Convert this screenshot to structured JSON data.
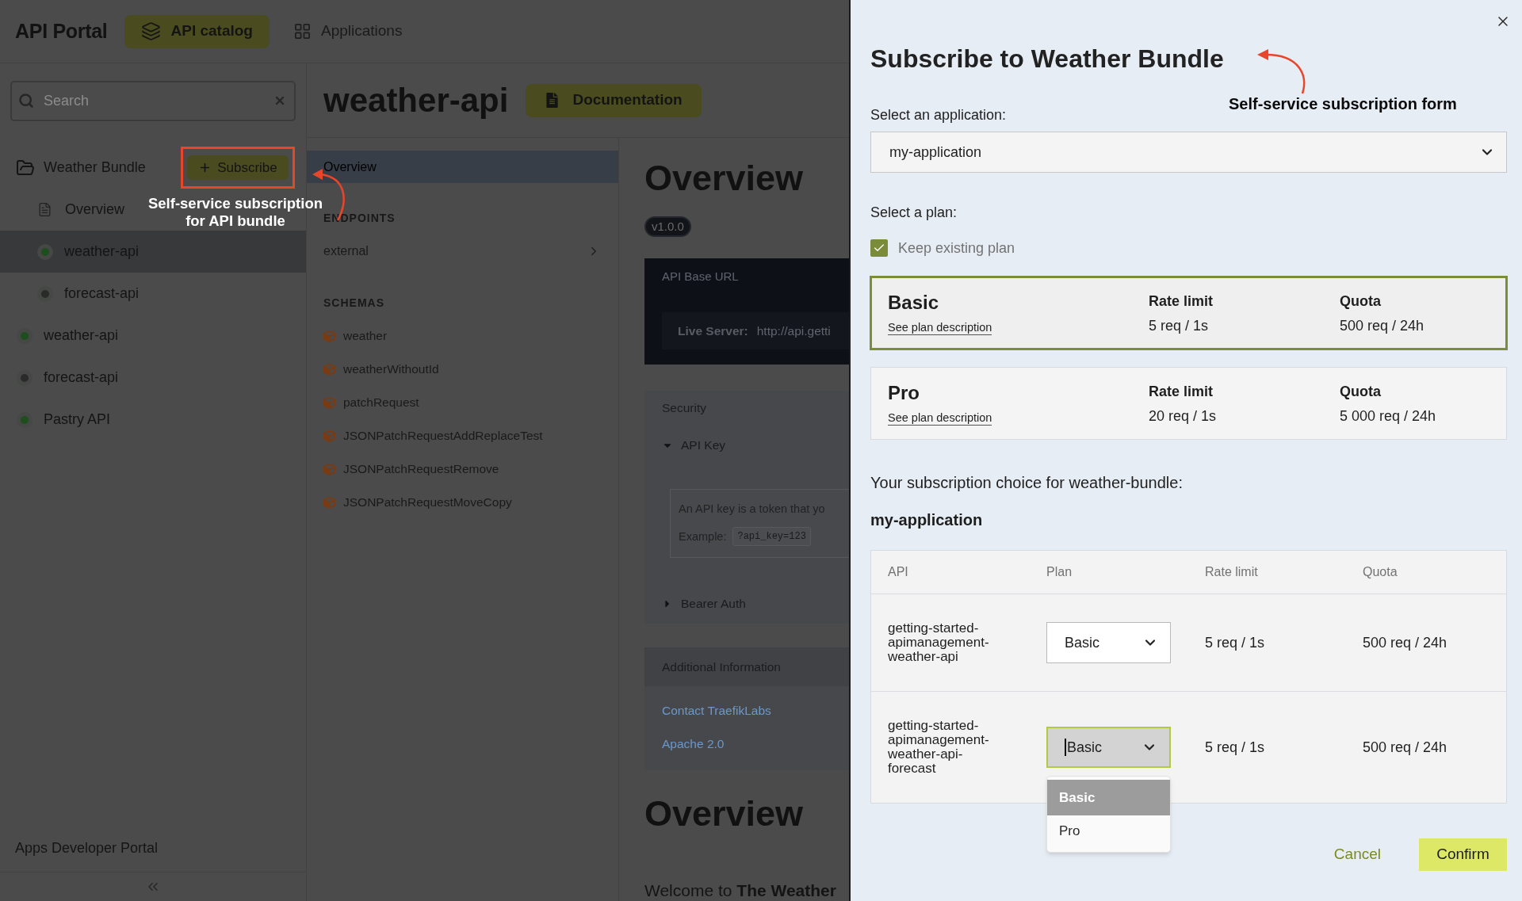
{
  "header": {
    "logo": "API Portal",
    "tabs": [
      {
        "label": "API catalog",
        "selected": true
      },
      {
        "label": "Applications",
        "selected": false
      }
    ]
  },
  "sidebar": {
    "search": {
      "placeholder": "Search"
    },
    "items": [
      {
        "kind": "bundle",
        "label": "Weather Bundle",
        "action": "Subscribe",
        "children": [
          {
            "kind": "doc",
            "label": "Overview",
            "selected": false
          },
          {
            "kind": "api",
            "label": "weather-api",
            "selected": true,
            "color": "#1e4d1e"
          },
          {
            "kind": "api",
            "label": "forecast-api",
            "selected": false,
            "color": "#2a2a2a"
          }
        ]
      },
      {
        "kind": "api",
        "label": "weather-api",
        "selected": false,
        "color": "#1e4d1e"
      },
      {
        "kind": "api",
        "label": "forecast-api",
        "selected": false,
        "color": "#2a2a2a"
      },
      {
        "kind": "api",
        "label": "Pastry API",
        "selected": false,
        "color": "#1e4d1e"
      }
    ],
    "footer": "Apps Developer Portal"
  },
  "api": {
    "title": "weather-api",
    "doc_button": "Documentation",
    "nav": {
      "items": [
        {
          "label": "Overview",
          "selected": true
        }
      ],
      "sections": [
        {
          "heading": "ENDPOINTS",
          "items": [
            {
              "kind": "endpoint",
              "label": "external"
            }
          ]
        },
        {
          "heading": "SCHEMAS",
          "items": [
            {
              "kind": "schema",
              "label": "weather"
            },
            {
              "kind": "schema",
              "label": "weatherWithoutId"
            },
            {
              "kind": "schema",
              "label": "patchRequest"
            },
            {
              "kind": "schema",
              "label": "JSONPatchRequestAddReplaceTest"
            },
            {
              "kind": "schema",
              "label": "JSONPatchRequestRemove"
            },
            {
              "kind": "schema",
              "label": "JSONPatchRequestMoveCopy"
            }
          ]
        }
      ]
    },
    "content": {
      "heading": "Overview",
      "version": "v1.0.0",
      "base_url": {
        "title": "API Base URL",
        "server_label": "Live Server:",
        "server_url": "http://api.getti"
      },
      "security": {
        "title": "Security",
        "schemes": [
          {
            "label": "API Key",
            "expanded": true,
            "description": "An API key is a token that yo",
            "example_label": "Example:",
            "example_code": "?api_key=123"
          },
          {
            "label": "Bearer Auth",
            "expanded": false
          }
        ]
      },
      "additional": {
        "title": "Additional Information",
        "links": [
          "Contact TraefikLabs",
          "Apache 2.0"
        ]
      },
      "heading_2": "Overview",
      "intro": "Welcome to **The Weather**"
    }
  },
  "modal": {
    "title": "Subscribe to Weather Bundle",
    "app_label": "Select an application:",
    "app_value": "my-application",
    "plan_label": "Select a plan:",
    "keep_plan": {
      "label": "Keep existing plan",
      "checked": true
    },
    "plans": [
      {
        "name": "Basic",
        "link": "See plan description",
        "rate_label": "Rate limit",
        "rate": "5 req / 1s",
        "quota_label": "Quota",
        "quota": "500 req / 24h",
        "selected": true
      },
      {
        "name": "Pro",
        "link": "See plan description",
        "rate_label": "Rate limit",
        "rate": "20 req / 1s",
        "quota_label": "Quota",
        "quota": "5 000 req / 24h",
        "selected": false
      }
    ],
    "summary_label": "Your subscription choice for weather-bundle:",
    "summary_app": "my-application",
    "table": {
      "columns": [
        "API",
        "Plan",
        "Rate limit",
        "Quota"
      ],
      "rows": [
        {
          "api": "getting-started-apimanagement-weather-api",
          "plan": "Basic",
          "rate": "5 req / 1s",
          "quota": "500 req / 24h",
          "focused": false
        },
        {
          "api": "getting-started-apimanagement-weather-api-forecast",
          "plan": "Basic",
          "rate": "5 req / 1s",
          "quota": "500 req / 24h",
          "focused": true,
          "options": [
            {
              "label": "Basic",
              "selected": true
            },
            {
              "label": "Pro",
              "selected": false
            }
          ]
        }
      ]
    },
    "buttons": [
      {
        "kind": "cancel",
        "label": "Cancel"
      },
      {
        "kind": "confirm",
        "label": "Confirm"
      }
    ]
  },
  "annotations": [
    {
      "kind": "bundle",
      "text": "Self-service subscription for API bundle"
    },
    {
      "kind": "form",
      "text": "Self-service subscription form"
    }
  ]
}
